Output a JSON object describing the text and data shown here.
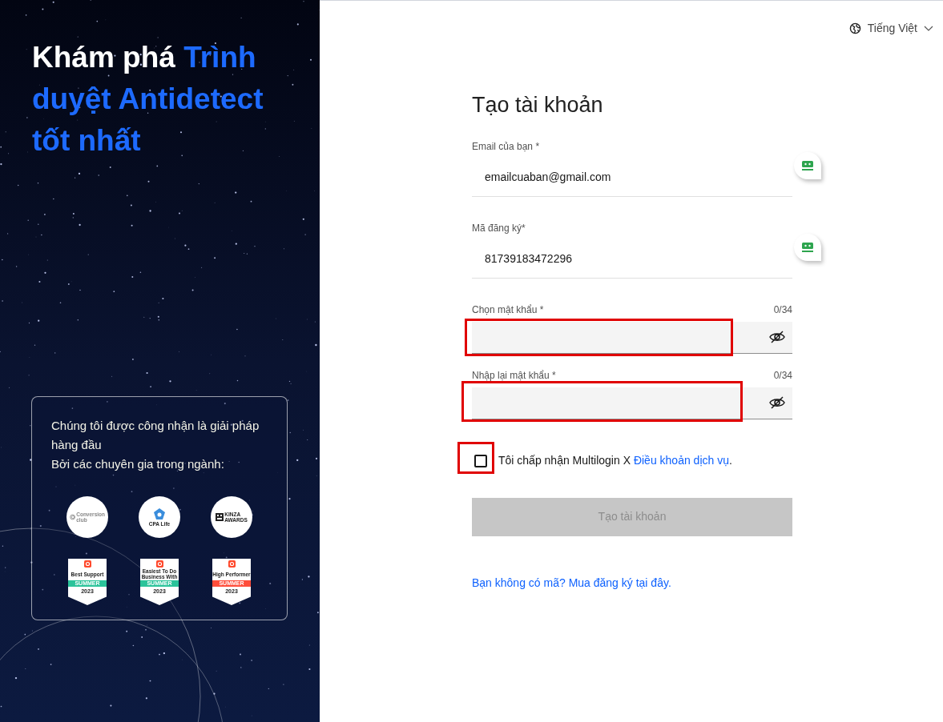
{
  "hero": {
    "heading_parts": [
      {
        "text": "Khám phá ",
        "accent": false
      },
      {
        "text": "Trình duyệt Antidetect tốt nhất",
        "accent": true
      }
    ]
  },
  "recognition": {
    "lines": [
      "Chúng tôi được công nhận là giải pháp hàng đầu",
      "Bởi các chuyên gia trong ngành:"
    ],
    "logos": [
      {
        "kind": "rings",
        "lines": [
          "Conversion",
          "club"
        ]
      },
      {
        "kind": "pentagon",
        "lines": [
          "CPA Life"
        ]
      },
      {
        "kind": "kinza",
        "lines": [
          "KINZA",
          "AWARDS"
        ]
      }
    ],
    "badges": [
      {
        "title": "Best Support",
        "season": "SUMMER",
        "year": "2023",
        "color": "#2bc39a"
      },
      {
        "title": "Easiest To Do Business With",
        "season": "SUMMER",
        "year": "2023",
        "color": "#2bc39a"
      },
      {
        "title": "High Performer",
        "season": "SUMMER",
        "year": "2023",
        "color": "#ff4d3a"
      }
    ]
  },
  "language": {
    "label": "Tiếng Việt"
  },
  "form": {
    "title": "Tạo tài khoản",
    "fields": [
      {
        "kind": "text",
        "label": "Email của bạn *",
        "value": "emailcuaban@gmail.com",
        "autofill_icon": true,
        "highlighted": false
      },
      {
        "kind": "text",
        "label": "Mã đăng ký*",
        "value": "81739183472296",
        "autofill_icon": true,
        "highlighted": false
      },
      {
        "kind": "password",
        "label": "Chọn mật khẩu *",
        "counter": "0/34",
        "highlighted": true
      },
      {
        "kind": "password",
        "label": "Nhập lại mật khẩu *",
        "counter": "0/34",
        "highlighted": true
      }
    ],
    "terms": {
      "checked": false,
      "highlighted": true,
      "text": "Tôi chấp nhận Multilogin X ",
      "link": "Điều khoản dịch vụ",
      "suffix": "."
    },
    "submit": {
      "label": "Tạo tài khoản",
      "disabled": true
    },
    "footer_link": "Bạn không có mã? Mua đăng ký tại đây."
  }
}
